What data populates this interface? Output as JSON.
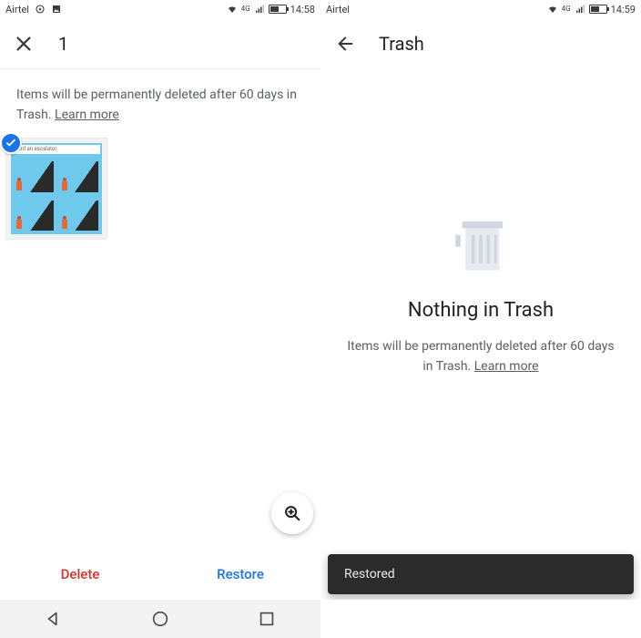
{
  "left": {
    "status": {
      "carrier": "Airtel",
      "fg_label": "4G",
      "time": "14:58"
    },
    "appbar": {
      "selected_count": "1"
    },
    "info": {
      "text_before": "Items will be permanently deleted after 60 days in Trash. ",
      "learn_more": "Learn more"
    },
    "thumb": {
      "caption": "oard an escalator"
    },
    "actions": {
      "delete": "Delete",
      "restore": "Restore"
    }
  },
  "right": {
    "status": {
      "carrier": "Airtel",
      "fg_label": "4G",
      "time": "14:59"
    },
    "appbar": {
      "title": "Trash"
    },
    "empty": {
      "heading": "Nothing in Trash",
      "text_before": "Items will be permanently deleted after 60 days in Trash. ",
      "learn_more": "Learn more"
    },
    "toast": "Restored"
  }
}
